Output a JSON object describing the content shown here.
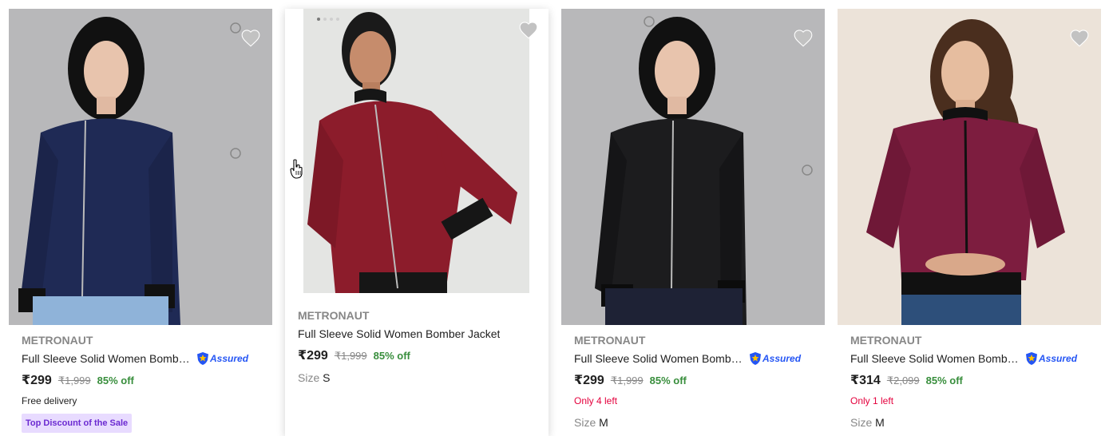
{
  "products": [
    {
      "brand": "METRONAUT",
      "title": "Full Sleeve Solid Women Bombe...",
      "assured": "Assured",
      "price": "₹299",
      "mrp": "₹1,999",
      "discount": "85% off",
      "delivery": "Free delivery",
      "badge": "Top Discount of the Sale",
      "jacket_color": "#1f2a55",
      "image_bg": "#b8b8ba"
    },
    {
      "brand": "METRONAUT",
      "title": "Full Sleeve Solid Women Bomber Jacket",
      "price": "₹299",
      "mrp": "₹1,999",
      "discount": "85% off",
      "size_label": "Size",
      "size_value": "S",
      "jacket_color": "#8c1c2b",
      "image_bg": "#e4e5e3"
    },
    {
      "brand": "METRONAUT",
      "title": "Full Sleeve Solid Women Bombe...",
      "assured": "Assured",
      "price": "₹299",
      "mrp": "₹1,999",
      "discount": "85% off",
      "stock": "Only 4 left",
      "size_label": "Size",
      "size_value": "M",
      "jacket_color": "#1c1c1e",
      "image_bg": "#b8b8ba"
    },
    {
      "brand": "METRONAUT",
      "title": "Full Sleeve Solid Women Bombe...",
      "assured": "Assured",
      "price": "₹314",
      "mrp": "₹2,099",
      "discount": "85% off",
      "stock": "Only 1 left",
      "size_label": "Size",
      "size_value": "M",
      "jacket_color": "#7d1d3f",
      "image_bg": "#ece3d9"
    }
  ],
  "icons": {
    "wishlist": "heart-icon",
    "assured": "assured-shield-icon",
    "cursor": "hand-pointer-icon"
  },
  "colors": {
    "discount_green": "#388e3c",
    "stock_red": "#e4013d",
    "assured_blue": "#2455f4",
    "badge_bg": "#e8dbff",
    "badge_text": "#6b2ad1"
  }
}
